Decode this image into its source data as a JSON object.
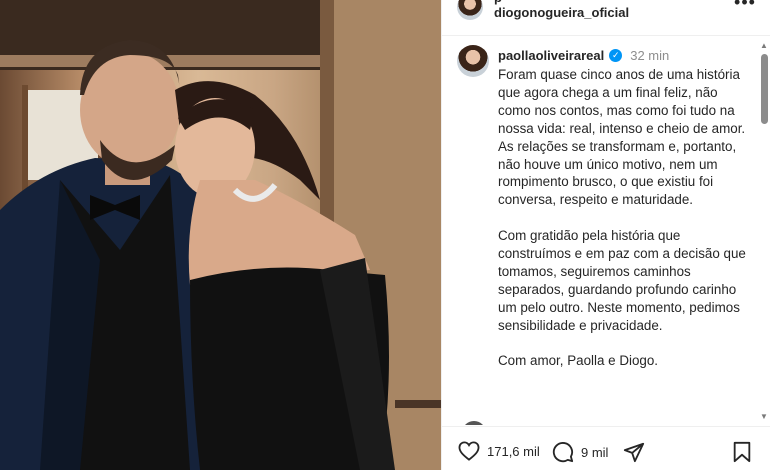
{
  "post": {
    "header_user_clipped": "p",
    "header_user": "diogonogueira_oficial",
    "more_icon": "more-horizontal-icon"
  },
  "caption": {
    "user": "paollaoliveirareal",
    "verified_icon": "verified-badge-icon",
    "time": "32 min",
    "paragraphs": [
      "Foram quase cinco anos de uma história que agora chega a um final feliz, não como nos contos, mas como foi tudo na nossa vida: real, intenso e cheio de amor. As relações se transformam e, portanto, não houve um único motivo, nem um rompimento brusco, o que existiu foi conversa, respeito e maturidade.",
      "Com gratidão pela história que construímos e em paz com a decisão que tomamos, seguiremos caminhos separados, guardando profundo carinho um pelo outro. Neste momento, pedimos sensibilidade e privacidade.",
      "Com amor, Paolla e Diogo."
    ]
  },
  "actions": {
    "like_icon": "heart-icon",
    "likes": "171,6 mil",
    "comment_icon": "comment-icon",
    "comments": "9 mil",
    "share_icon": "share-icon",
    "save_icon": "bookmark-icon"
  },
  "colors": {
    "verified": "#0095f6",
    "text": "#262626",
    "muted": "#8e8e8e"
  }
}
